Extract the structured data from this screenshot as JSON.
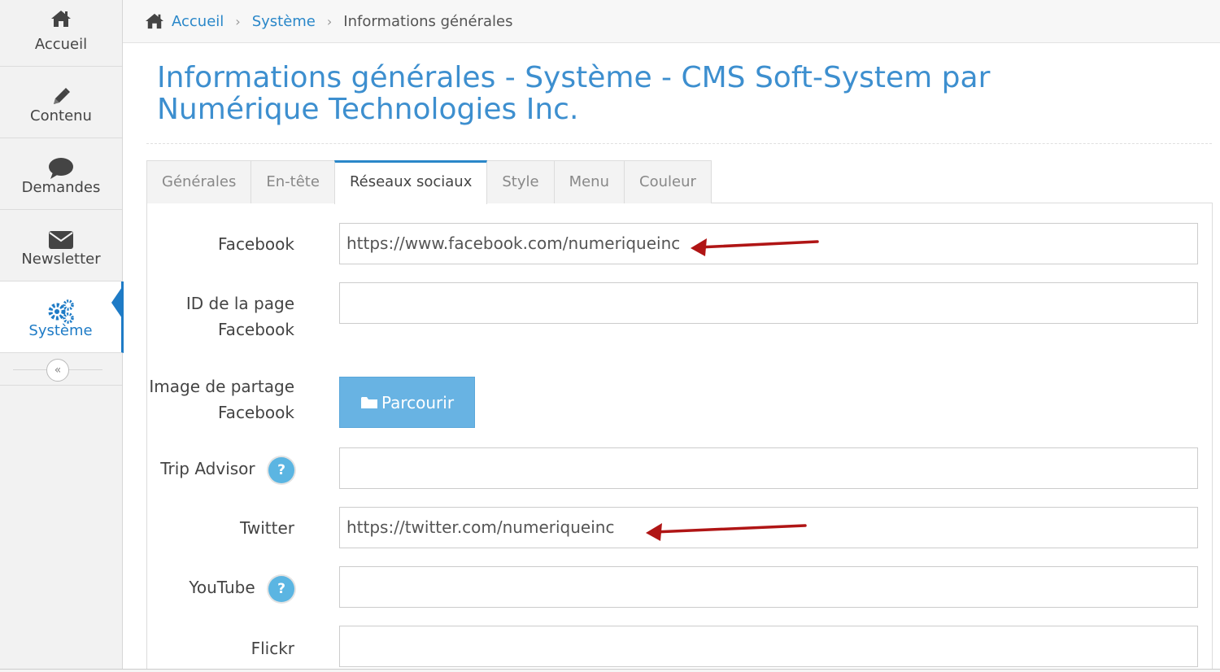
{
  "sidebar": {
    "items": [
      {
        "label": "Accueil",
        "icon": "home-icon"
      },
      {
        "label": "Contenu",
        "icon": "pencil-icon"
      },
      {
        "label": "Demandes",
        "icon": "comment-icon"
      },
      {
        "label": "Newsletter",
        "icon": "envelope-icon"
      },
      {
        "label": "Système",
        "icon": "gears-icon",
        "active": true
      }
    ],
    "collapse_glyph": "«"
  },
  "breadcrumb": {
    "home": "Accueil",
    "section": "Système",
    "current": "Informations générales",
    "separator": "›"
  },
  "page": {
    "title": "Informations générales - Système - CMS Soft-System par Numérique Technologies Inc."
  },
  "tabs": [
    {
      "label": "Générales"
    },
    {
      "label": "En-tête"
    },
    {
      "label": "Réseaux sociaux",
      "active": true
    },
    {
      "label": "Style"
    },
    {
      "label": "Menu"
    },
    {
      "label": "Couleur"
    }
  ],
  "form": {
    "facebook": {
      "label": "Facebook",
      "value": "https://www.facebook.com/numeriqueinc"
    },
    "facebook_page_id": {
      "label_line1": "ID de la page",
      "label_line2": "Facebook",
      "value": ""
    },
    "share_image": {
      "label_line1": "Image de partage",
      "label_line2": "Facebook",
      "button": "Parcourir"
    },
    "tripadvisor": {
      "label": "Trip Advisor",
      "help": "?",
      "value": ""
    },
    "twitter": {
      "label": "Twitter",
      "value": "https://twitter.com/numeriqueinc"
    },
    "youtube": {
      "label": "YouTube",
      "help": "?",
      "value": ""
    },
    "flickr": {
      "label": "Flickr",
      "value": ""
    }
  },
  "colors": {
    "accent": "#1e7bc6",
    "title": "#3d8fcf",
    "button": "#68b3e3",
    "arrow": "#b01515"
  }
}
